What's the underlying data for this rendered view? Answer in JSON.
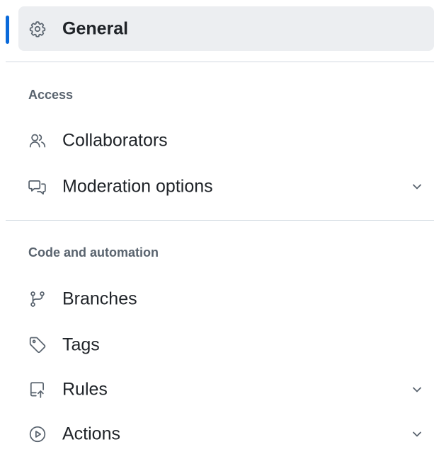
{
  "nav": {
    "general": {
      "label": "General",
      "icon": "gear-icon",
      "active": true
    },
    "sections": [
      {
        "heading": "Access",
        "items": [
          {
            "label": "Collaborators",
            "icon": "people-icon",
            "expandable": false
          },
          {
            "label": "Moderation options",
            "icon": "comment-discussion-icon",
            "expandable": true
          }
        ]
      },
      {
        "heading": "Code and automation",
        "items": [
          {
            "label": "Branches",
            "icon": "git-branch-icon",
            "expandable": false
          },
          {
            "label": "Tags",
            "icon": "tag-icon",
            "expandable": false
          },
          {
            "label": "Rules",
            "icon": "repo-push-icon",
            "expandable": true
          },
          {
            "label": "Actions",
            "icon": "play-icon",
            "expandable": true
          }
        ]
      }
    ]
  },
  "colors": {
    "accent": "#0969da",
    "active_bg": "#eceef1",
    "text": "#1f2328",
    "muted": "#59636e",
    "divider": "#d1d9e0"
  }
}
